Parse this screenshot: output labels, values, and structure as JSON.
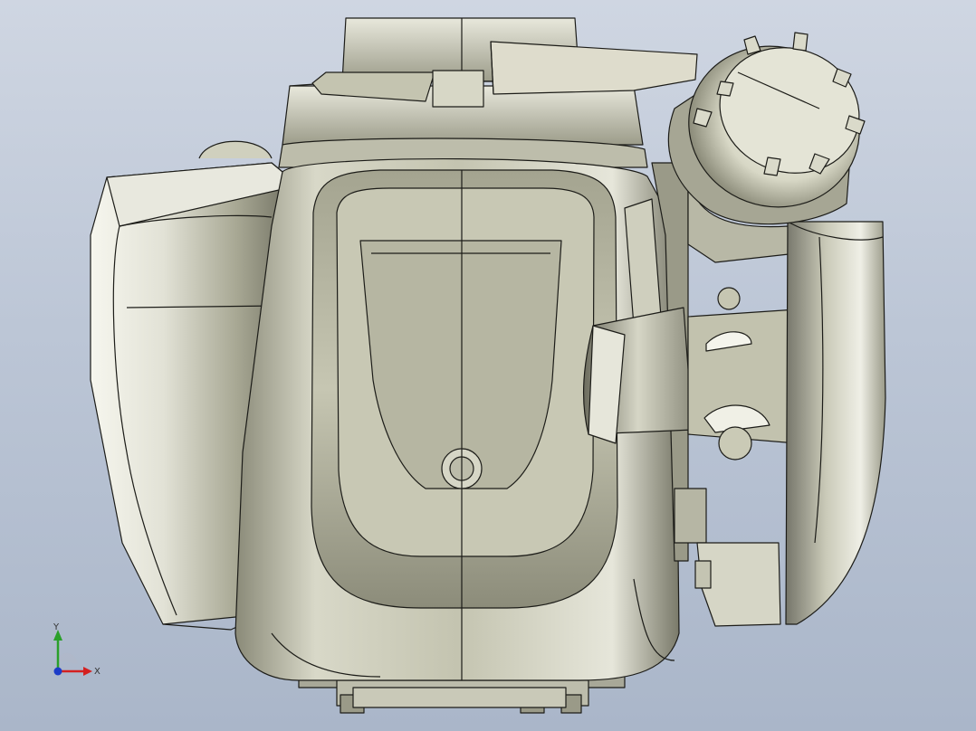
{
  "viewport": {
    "background_top": "#cfd6e2",
    "background_bottom": "#aab6c9"
  },
  "model": {
    "subject": "engine-assembly-front-view",
    "shade_light": "#f2f2ea",
    "shade_mid": "#c8c8b4",
    "shade_dark": "#6e6e60",
    "edge_color": "#1c1c18"
  },
  "triad": {
    "x_label": "X",
    "y_label": "Y",
    "x_color": "#d42020",
    "y_color": "#2aa02a",
    "z_color": "#1c3cc8"
  }
}
